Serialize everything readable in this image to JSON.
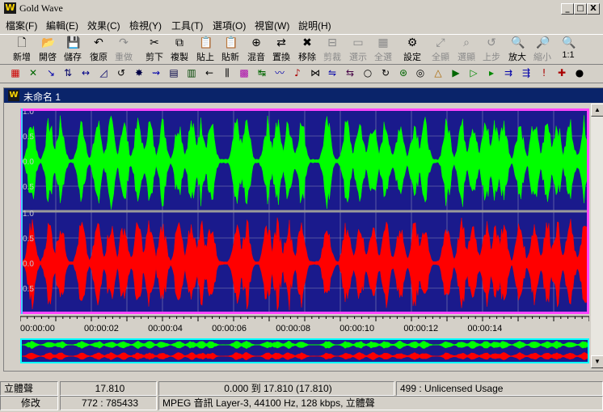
{
  "window": {
    "title": "Gold Wave",
    "logo": "W",
    "controls": [
      "_",
      "□",
      "X"
    ]
  },
  "menu": [
    "檔案(F)",
    "編輯(E)",
    "效果(C)",
    "檢視(Y)",
    "工具(T)",
    "選項(O)",
    "視窗(W)",
    "說明(H)"
  ],
  "toolbar": [
    {
      "label": "新增",
      "icon": "new-file-icon",
      "enabled": true
    },
    {
      "label": "開啓",
      "icon": "open-folder-icon",
      "enabled": true
    },
    {
      "label": "儲存",
      "icon": "save-icon",
      "enabled": true
    },
    {
      "label": "復原",
      "icon": "undo-icon",
      "enabled": true
    },
    {
      "label": "重做",
      "icon": "redo-icon",
      "enabled": false
    },
    {
      "label": "剪下",
      "icon": "scissors-icon",
      "enabled": true
    },
    {
      "label": "複製",
      "icon": "copy-icon",
      "enabled": true
    },
    {
      "label": "貼上",
      "icon": "paste-icon",
      "enabled": true
    },
    {
      "label": "貼新",
      "icon": "paste-new-icon",
      "enabled": true
    },
    {
      "label": "混音",
      "icon": "mix-icon",
      "enabled": true
    },
    {
      "label": "置換",
      "icon": "replace-icon",
      "enabled": true
    },
    {
      "label": "移除",
      "icon": "delete-icon",
      "enabled": true
    },
    {
      "label": "剪裁",
      "icon": "trim-icon",
      "enabled": false
    },
    {
      "label": "選示",
      "icon": "select-view-icon",
      "enabled": false
    },
    {
      "label": "全選",
      "icon": "select-all-icon",
      "enabled": false
    },
    {
      "label": "設定",
      "icon": "settings-icon",
      "enabled": true
    },
    {
      "label": "全顯",
      "icon": "zoom-all-icon",
      "enabled": false
    },
    {
      "label": "選顯",
      "icon": "zoom-selection-icon",
      "enabled": false
    },
    {
      "label": "上步",
      "icon": "zoom-previous-icon",
      "enabled": false
    },
    {
      "label": "放大",
      "icon": "zoom-in-icon",
      "enabled": true
    },
    {
      "label": "縮小",
      "icon": "zoom-out-icon",
      "enabled": false
    },
    {
      "label": "1:1",
      "icon": "zoom-1-1-icon",
      "enabled": true
    }
  ],
  "effects_toolbar": [
    "channel-icon",
    "mute-icon",
    "fade-in-icon",
    "stereo-icon",
    "volume-icon",
    "fade-icon",
    "loop-icon",
    "filter-icon",
    "echo-icon",
    "equalizer-icon",
    "spectrum-icon",
    "back-arrow-icon",
    "resample-icon",
    "noise-icon",
    "offset-icon",
    "flanger-icon",
    "pitch-icon",
    "mechanize-icon",
    "reverse-icon",
    "doppler-icon",
    "marker-icon",
    "time-warp-icon",
    "compressor-icon",
    "invert-icon",
    "silence-icon",
    "playback-rate-icon",
    "transpose-icon",
    "play-icon",
    "insert-silence-icon",
    "dynamics-icon",
    "alert-icon",
    "repair-icon",
    "shield-icon"
  ],
  "document": {
    "title": "未命名 1",
    "icon": "W"
  },
  "waveform": {
    "channels": [
      {
        "name": "left",
        "color": "#00ff00",
        "ticks": [
          "1.0",
          "0.5",
          "0.0",
          "0.5"
        ]
      },
      {
        "name": "right",
        "color": "#ff0000",
        "ticks": [
          "1.0",
          "0.5",
          "0.0",
          "0.5"
        ]
      }
    ],
    "background": "#1a1a8c",
    "selection_color": "#ff44ff",
    "duration_seconds": 17.81,
    "time_labels": [
      "00:00:00",
      "00:00:02",
      "00:00:04",
      "00:00:06",
      "00:00:08",
      "00:00:10",
      "00:00:12",
      "00:00:14"
    ]
  },
  "status": {
    "channels": "立體聲",
    "length": "17.810",
    "selection": "0.000 到 17.810 (17.810)",
    "license": "499 : Unlicensed Usage",
    "state": "修改",
    "position": "772 : 785433",
    "format": "MPEG 音訊  Layer-3, 44100 Hz, 128 kbps, 立體聲"
  }
}
